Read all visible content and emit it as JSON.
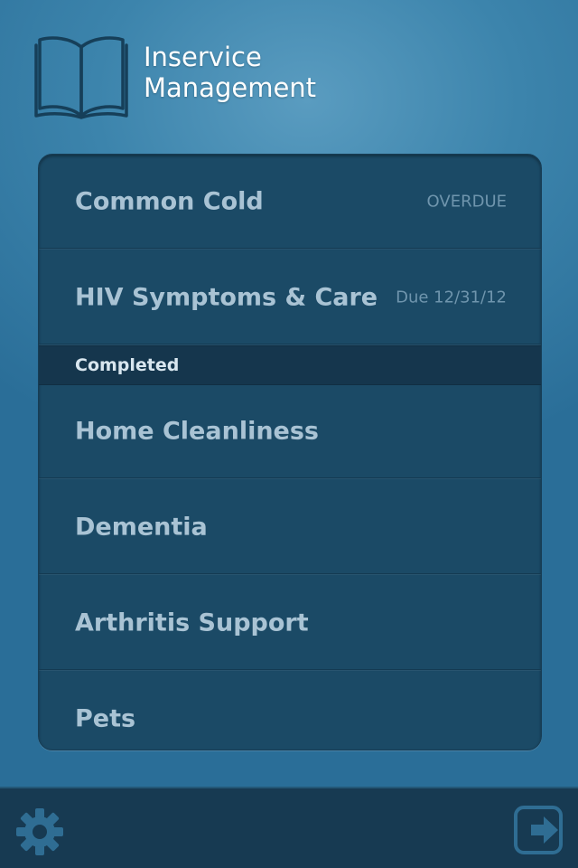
{
  "app": {
    "title_line1": "Inservice",
    "title_line2": "Management",
    "logo_icon": "book-icon"
  },
  "pending_items": [
    {
      "label": "Common Cold",
      "status": "OVERDUE"
    },
    {
      "label": "HIV Symptoms & Care",
      "status": "Due 12/31/12"
    }
  ],
  "completed_section": {
    "header": "Completed",
    "items": [
      {
        "label": "Home Cleanliness"
      },
      {
        "label": "Dementia"
      },
      {
        "label": "Arthritis Support"
      },
      {
        "label": "Pets"
      }
    ]
  },
  "footer": {
    "settings_icon": "gear-icon",
    "logout_icon": "exit-icon"
  },
  "colors": {
    "background": "#3c84ac",
    "panel": "#1b4a66",
    "section_header": "#15364d",
    "footer": "#173a52",
    "label_text": "#a9c3d4",
    "status_text": "#6f95ad"
  }
}
